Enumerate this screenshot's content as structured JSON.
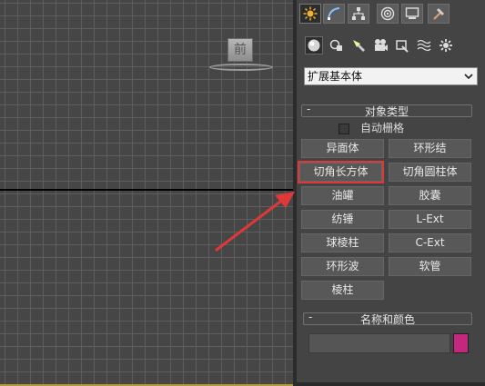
{
  "viewport": {
    "viewcube_label": "前"
  },
  "command_panel": {
    "tabs": [
      {
        "icon": "create-star-icon",
        "active": true
      },
      {
        "icon": "modify-arc-icon",
        "active": false
      },
      {
        "icon": "hierarchy-icon",
        "active": false
      },
      {
        "icon": "motion-icon",
        "active": false
      },
      {
        "icon": "display-icon",
        "active": false
      },
      {
        "icon": "utilities-hammer-icon",
        "active": false
      }
    ],
    "categories": [
      {
        "icon": "geometry-sphere-icon",
        "active": true
      },
      {
        "icon": "shapes-icon",
        "active": false
      },
      {
        "icon": "lights-icon",
        "active": false
      },
      {
        "icon": "cameras-icon",
        "active": false
      },
      {
        "icon": "helpers-icon",
        "active": false
      },
      {
        "icon": "space-warps-icon",
        "active": false
      },
      {
        "icon": "systems-icon",
        "active": false
      }
    ],
    "dropdown_value": "扩展基本体",
    "object_type": {
      "title": "对象类型",
      "collapse_symbol": "-",
      "autogrid_label": "自动栅格",
      "buttons": [
        "异面体",
        "环形结",
        "切角长方体",
        "切角圆柱体",
        "油罐",
        "胶囊",
        "纺锤",
        "L-Ext",
        "球棱柱",
        "C-Ext",
        "环形波",
        "软管",
        "棱柱"
      ]
    },
    "name_color": {
      "title": "名称和颜色",
      "collapse_symbol": "-",
      "name_value": "",
      "color": "#c4277e"
    }
  },
  "annotation": {
    "color": "#e03838"
  }
}
